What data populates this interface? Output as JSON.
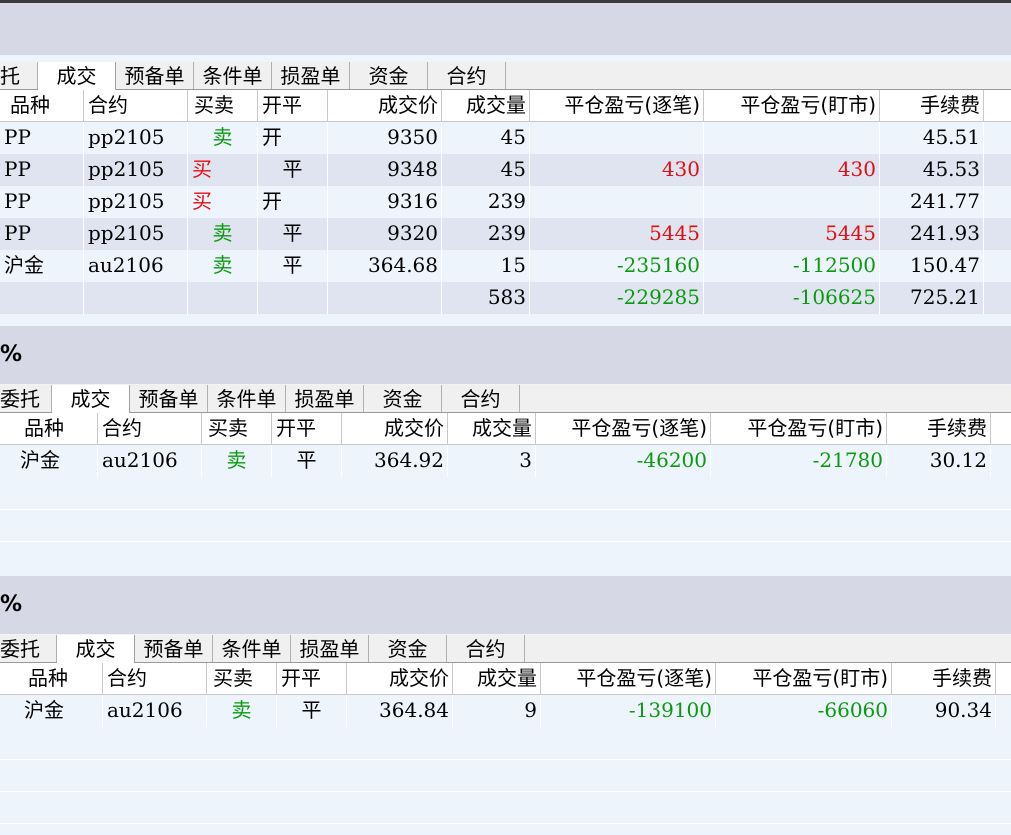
{
  "panels": [
    {
      "pct": "",
      "tabs": [
        "托",
        "成交",
        "预备单",
        "条件单",
        "损盈单",
        "资金",
        "合约"
      ],
      "active_tab": 1,
      "headers": [
        "品种",
        "合约",
        "买卖",
        "开平",
        "成交价",
        "成交量",
        "平仓盈亏(逐笔)",
        "平仓盈亏(盯市)",
        "手续费"
      ],
      "rows": [
        {
          "variety": "PP",
          "contract": "pp2105",
          "side": "卖",
          "side_color": "green",
          "side_align": "c",
          "oc": "开",
          "oc_align": "l",
          "price": "9350",
          "qty": "45",
          "pnl_trade": "",
          "pnl_mtm": "",
          "pnl_color": "red",
          "fee": "45.51"
        },
        {
          "variety": "PP",
          "contract": "pp2105",
          "side": "买",
          "side_color": "red",
          "side_align": "l",
          "oc": "平",
          "oc_align": "c",
          "price": "9348",
          "qty": "45",
          "pnl_trade": "430",
          "pnl_mtm": "430",
          "pnl_color": "red",
          "fee": "45.53"
        },
        {
          "variety": "PP",
          "contract": "pp2105",
          "side": "买",
          "side_color": "red",
          "side_align": "l",
          "oc": "开",
          "oc_align": "l",
          "price": "9316",
          "qty": "239",
          "pnl_trade": "",
          "pnl_mtm": "",
          "pnl_color": "red",
          "fee": "241.77"
        },
        {
          "variety": "PP",
          "contract": "pp2105",
          "side": "卖",
          "side_color": "green",
          "side_align": "c",
          "oc": "平",
          "oc_align": "c",
          "price": "9320",
          "qty": "239",
          "pnl_trade": "5445",
          "pnl_mtm": "5445",
          "pnl_color": "red",
          "fee": "241.93"
        },
        {
          "variety": "沪金",
          "contract": "au2106",
          "side": "卖",
          "side_color": "green",
          "side_align": "c",
          "oc": "平",
          "oc_align": "c",
          "price": "364.68",
          "qty": "15",
          "pnl_trade": "-235160",
          "pnl_mtm": "-112500",
          "pnl_color": "green",
          "fee": "150.47"
        },
        {
          "variety": "",
          "contract": "",
          "side": "",
          "side_color": "green",
          "side_align": "c",
          "oc": "",
          "oc_align": "c",
          "price": "",
          "qty": "583",
          "pnl_trade": "-229285",
          "pnl_mtm": "-106625",
          "pnl_color": "green",
          "fee": "725.21"
        }
      ]
    },
    {
      "pct": "%",
      "tabs": [
        "委托",
        "成交",
        "预备单",
        "条件单",
        "损盈单",
        "资金",
        "合约"
      ],
      "active_tab": 1,
      "headers": [
        "品种",
        "合约",
        "买卖",
        "开平",
        "成交价",
        "成交量",
        "平仓盈亏(逐笔)",
        "平仓盈亏(盯市)",
        "手续费"
      ],
      "rows": [
        {
          "variety": "沪金",
          "contract": "au2106",
          "side": "卖",
          "side_color": "green",
          "side_align": "c",
          "oc": "平",
          "oc_align": "c",
          "price": "364.92",
          "qty": "3",
          "pnl_trade": "-46200",
          "pnl_mtm": "-21780",
          "pnl_color": "green",
          "fee": "30.12"
        }
      ]
    },
    {
      "pct": "%",
      "tabs": [
        "委托",
        "成交",
        "预备单",
        "条件单",
        "损盈单",
        "资金",
        "合约"
      ],
      "active_tab": 1,
      "headers": [
        "品种",
        "合约",
        "买卖",
        "开平",
        "成交价",
        "成交量",
        "平仓盈亏(逐笔)",
        "平仓盈亏(盯市)",
        "手续费"
      ],
      "rows": [
        {
          "variety": "沪金",
          "contract": "au2106",
          "side": "卖",
          "side_color": "green",
          "side_align": "c",
          "oc": "平",
          "oc_align": "c",
          "price": "364.84",
          "qty": "9",
          "pnl_trade": "-139100",
          "pnl_mtm": "-66060",
          "pnl_color": "green",
          "fee": "90.34"
        }
      ]
    }
  ]
}
